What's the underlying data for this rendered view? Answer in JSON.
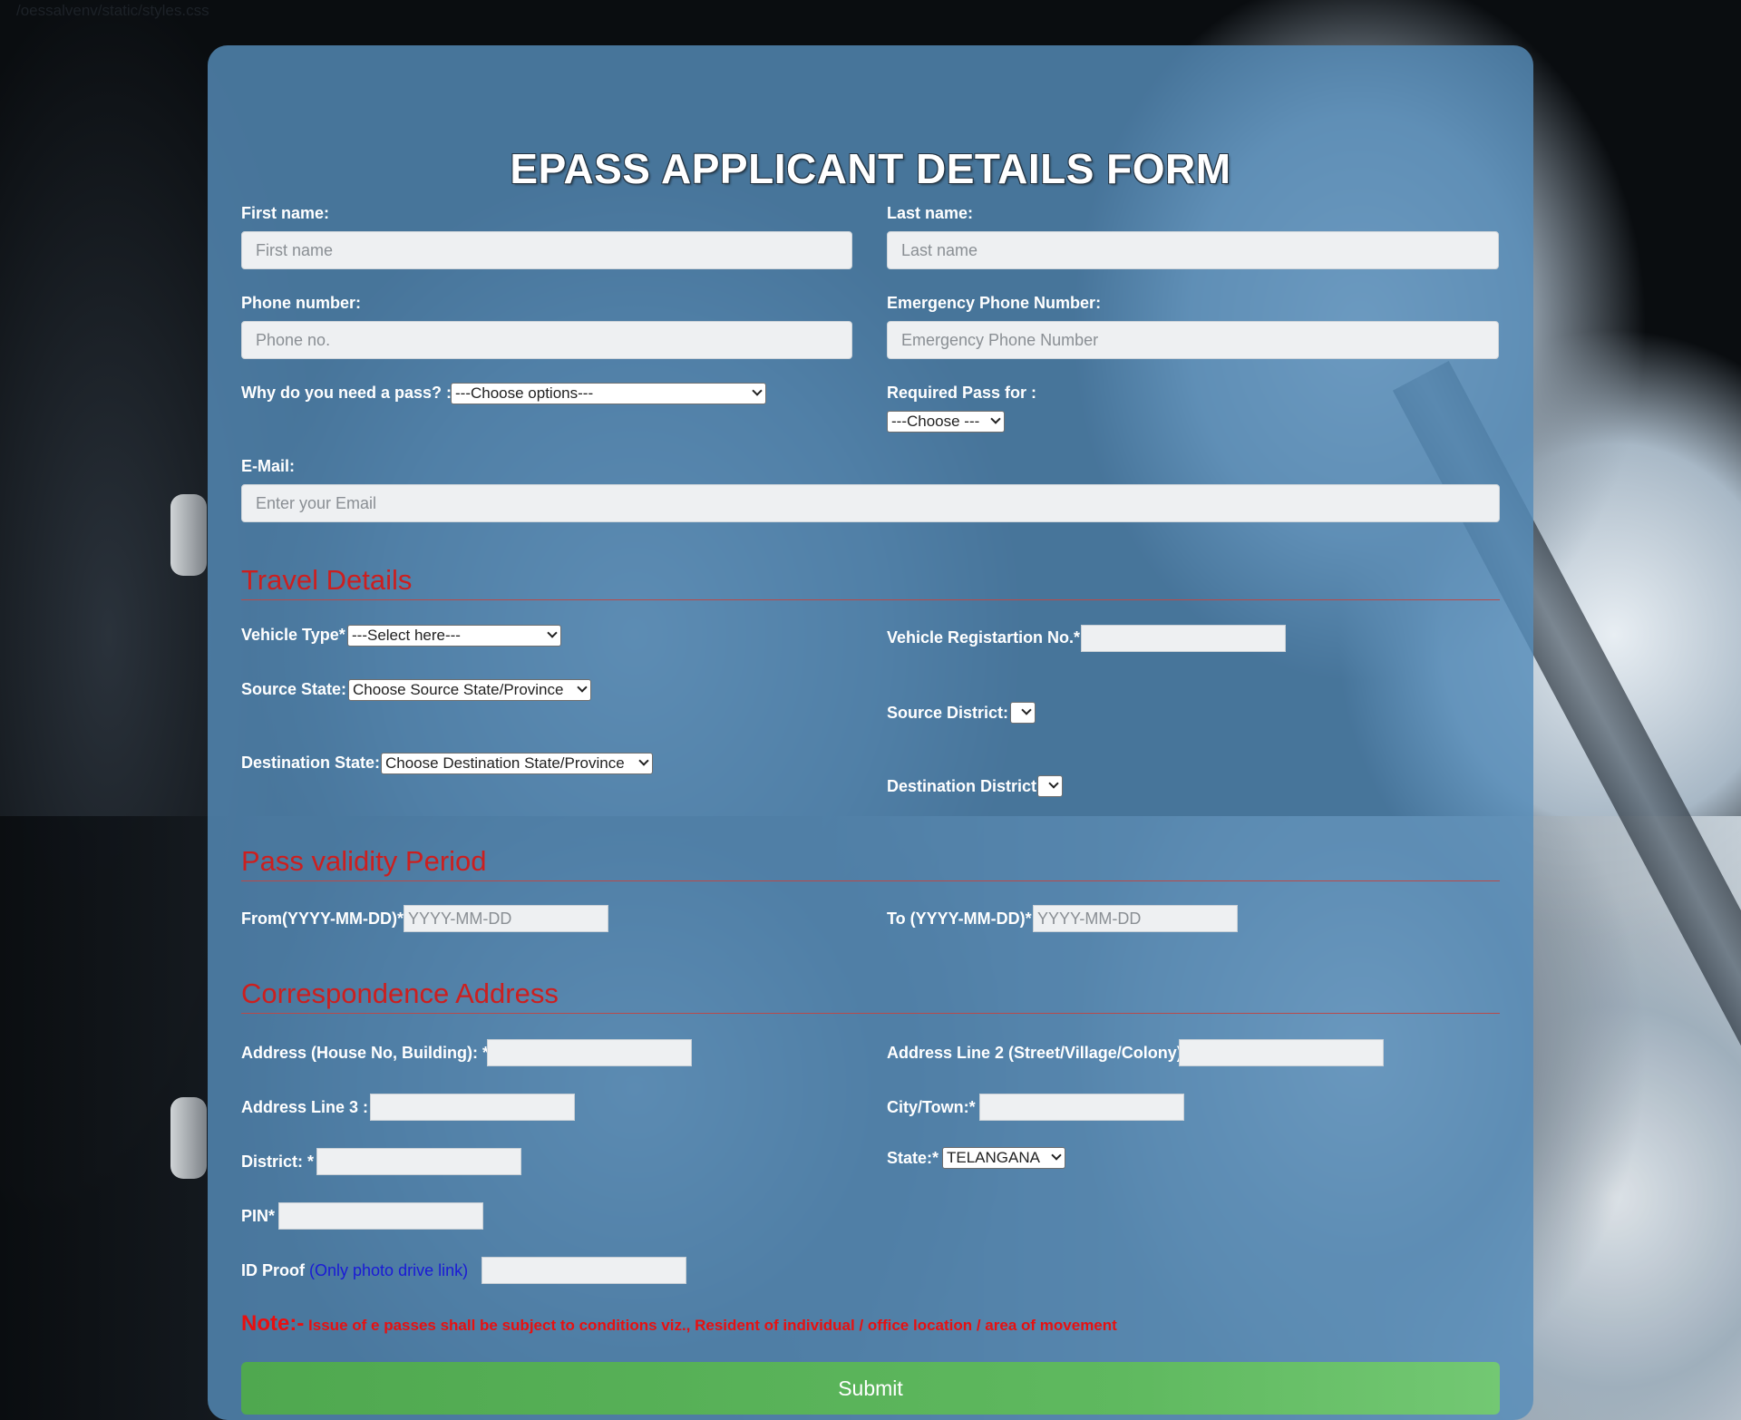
{
  "page": {
    "css_path": "/oessalvenv/static/styles.css"
  },
  "form": {
    "title": "EPASS APPLICANT DETAILS FORM",
    "first_name": {
      "label": "First name:",
      "placeholder": "First name"
    },
    "last_name": {
      "label": "Last name:",
      "placeholder": "Last name"
    },
    "phone": {
      "label": "Phone number:",
      "placeholder": "Phone no."
    },
    "emergency_phone": {
      "label": "Emergency Phone Number:",
      "placeholder": "Emergency Phone Number"
    },
    "reason": {
      "label": "Why do you need a pass? :",
      "selected": "---Choose options---"
    },
    "pass_for": {
      "label": "Required Pass for :",
      "selected": "---Choose ---"
    },
    "email": {
      "label": "E-Mail:",
      "placeholder": "Enter your Email"
    }
  },
  "travel": {
    "heading": "Travel Details",
    "vehicle_type": {
      "label": "Vehicle Type*",
      "selected": "---Select here---"
    },
    "vehicle_reg": {
      "label": "Vehicle Registartion No.*"
    },
    "source_state": {
      "label": "Source State:",
      "selected": "Choose Source State/Province"
    },
    "source_district": {
      "label": "Source District:",
      "selected": ""
    },
    "dest_state": {
      "label": "Destination State:",
      "selected": "Choose Destination State/Province"
    },
    "dest_district": {
      "label": "Destination District",
      "selected": ""
    }
  },
  "validity": {
    "heading": "Pass validity Period",
    "from": {
      "label": "From(YYYY-MM-DD)*",
      "placeholder": "YYYY-MM-DD"
    },
    "to": {
      "label": "To (YYYY-MM-DD)*",
      "placeholder": "YYYY-MM-DD"
    }
  },
  "address": {
    "heading": "Correspondence Address",
    "line1": {
      "label": "Address (House No, Building): *"
    },
    "line2": {
      "label": "Address Line 2 (Street/Village/Colony)"
    },
    "line3": {
      "label": "Address Line 3 :"
    },
    "city": {
      "label": "City/Town:*"
    },
    "district": {
      "label": "District: *"
    },
    "state": {
      "label": "State:*",
      "selected": "TELANGANA"
    },
    "pin": {
      "label": "PIN*"
    },
    "id_proof": {
      "label": "ID Proof",
      "hint": "(Only photo drive link)"
    }
  },
  "note": {
    "head": "Note:-",
    "body": " Issue of e passes shall be subject to conditions viz., Resident of individual / office location / area of movement"
  },
  "submit_label": "Submit",
  "colors": {
    "card": "#568cba",
    "section_heading": "#cc1f1f",
    "note": "#e81010",
    "link": "#1a1ad6",
    "submit": "#5cb85c"
  },
  "icons": {
    "select_arrow": "chevron-down-icon"
  }
}
